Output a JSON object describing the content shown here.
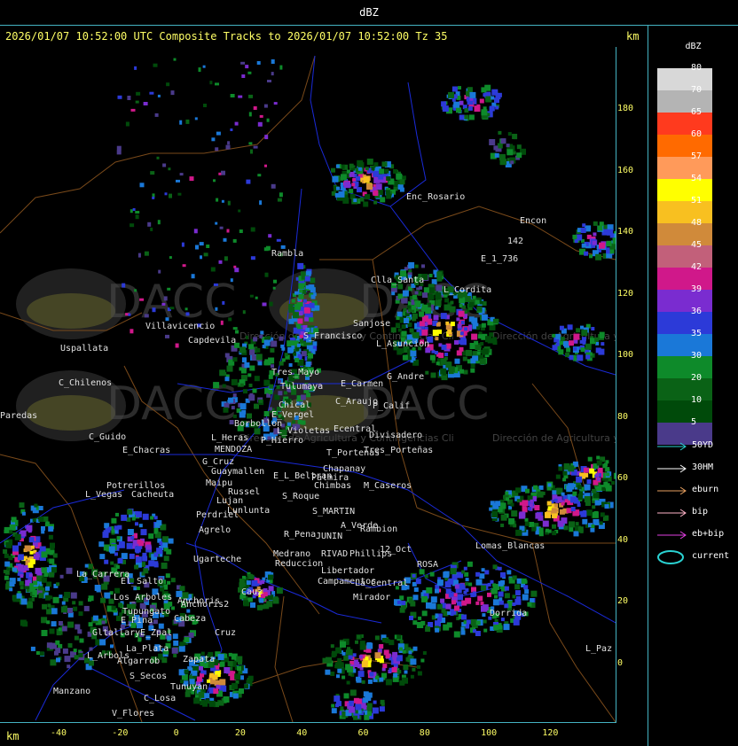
{
  "header": {
    "title": "dBZ"
  },
  "plot": {
    "title": "2026/01/07 10:52:00 UTC Composite Tracks to 2026/01/07 10:52:00 Tz 35",
    "unit_top": "km",
    "unit_bottom": "km",
    "watermark": "DACC",
    "watermark_sub": "Dirección de Agricultura y Contingencias Climáticas"
  },
  "y_ticks": [
    "180",
    "160",
    "140",
    "120",
    "100",
    "80",
    "60",
    "40",
    "20",
    "0"
  ],
  "x_ticks": [
    "-40",
    "-20",
    "0",
    "20",
    "40",
    "60",
    "80",
    "100",
    "120"
  ],
  "legend": {
    "title": "dBZ",
    "scale": [
      {
        "label": "80",
        "color": "#d8d8d8"
      },
      {
        "label": "70",
        "color": "#b4b4b4"
      },
      {
        "label": "65",
        "color": "#ff3a1e"
      },
      {
        "label": "60",
        "color": "#ff6a00"
      },
      {
        "label": "57",
        "color": "#ff9a5a"
      },
      {
        "label": "54",
        "color": "#ffff00"
      },
      {
        "label": "51",
        "color": "#f8c020"
      },
      {
        "label": "48",
        "color": "#d08a3a"
      },
      {
        "label": "45",
        "color": "#c2607a"
      },
      {
        "label": "42",
        "color": "#d0188a"
      },
      {
        "label": "39",
        "color": "#7a2cd0"
      },
      {
        "label": "36",
        "color": "#2c3ad8"
      },
      {
        "label": "35",
        "color": "#1a78d8"
      },
      {
        "label": "30",
        "color": "#0e8a2a"
      },
      {
        "label": "20",
        "color": "#0a6216"
      },
      {
        "label": "10",
        "color": "#004a0a"
      },
      {
        "label": "5",
        "color": "#4a3a8a"
      }
    ],
    "tracks": [
      {
        "label": "50YD",
        "color": "#2ad2d2"
      },
      {
        "label": "30HM",
        "color": "#ffffff"
      },
      {
        "label": "eburn",
        "color": "#e8a060"
      },
      {
        "label": "bip",
        "color": "#ffb4c8"
      },
      {
        "label": "eb+bip",
        "color": "#e040e0"
      },
      {
        "label": "current",
        "color": "#2ad2d2"
      }
    ]
  },
  "places": [
    "Uspallata",
    "C_Chilenos",
    "Paredas",
    "C_Guido",
    "E_Chacras",
    "Potrerillos",
    "L_Vegas",
    "Cacheuta",
    "Villavicencio",
    "Capdevila",
    "L_Heras",
    "MENDOZA",
    "G_Cruz",
    "Guaymallen",
    "Maipu",
    "Russel",
    "Lujan",
    "Lunlunta",
    "Perdriel",
    "Agrelo",
    "Ugarteche",
    "La_Carrera",
    "El_Salto",
    "Los_Arboles",
    "Tupungato",
    "Anchoris",
    "Zapata",
    "Gltallary",
    "E_Zpal",
    "L_Arbols",
    "La_Plata",
    "Algarrob",
    "S_Secos",
    "Tunuyan",
    "Manzano",
    "V_Flores",
    "C_Losa",
    "Rambla",
    "Clla_Santa",
    "Sanjose",
    "S_Francisco",
    "L_Asuncion",
    "Tres_Mayo",
    "Tulumaya",
    "E_Carmen",
    "G_Andre",
    "C_Araujo",
    "P_Calif",
    "Chical",
    "E_Vergel",
    "Borbollon",
    "L_Violetas",
    "P_Hierro",
    "Ecentral",
    "Divisadero",
    "T_Portenas",
    "Palmira",
    "Chapanay",
    "E_L_Beltran",
    "Chimbas",
    "S_Roque",
    "M_Caseros",
    "S_MARTIN",
    "A_Verde",
    "Rambion",
    "R_Pena",
    "JUNIN",
    "Medrano",
    "Reduccion",
    "RIVAD",
    "Phillips",
    "12_Oct",
    "Libertador",
    "Campamentos",
    "La_Central",
    "ROSA",
    "Mirador",
    "Dorrida",
    "Lomas_Blancas",
    "L_Paz",
    "Enc_Rosario",
    "Encon",
    "E_1_736",
    "L_Cordita",
    "142",
    "Cabeza",
    "Cauz",
    "Anchoris2",
    "Cruz",
    "E_Pina",
    "Tres_Porteñas"
  ]
}
